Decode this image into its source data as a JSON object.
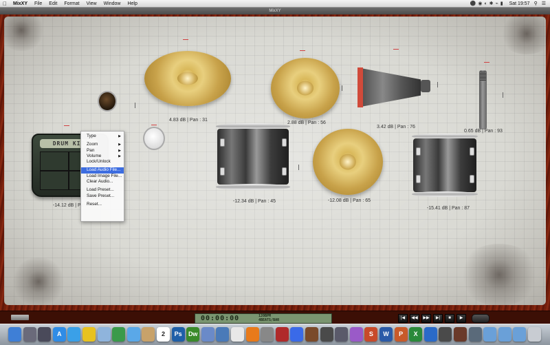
{
  "menubar": {
    "apple_icon": "apple-icon",
    "app_name": "MixXY",
    "items": [
      "File",
      "Edit",
      "Format",
      "View",
      "Window",
      "Help"
    ],
    "clock": "Sat 19:57"
  },
  "window": {
    "title": "MixXY"
  },
  "drum_kit": {
    "title": "DRUM KIT",
    "label": "-14.12 dB | Pan : 25"
  },
  "instruments": [
    {
      "name": "crash-cymbal",
      "label": "4.83 dB | Pan : 31"
    },
    {
      "name": "ride-cymbal",
      "label": "2.88 dB | Pan : 56"
    },
    {
      "name": "cowbell",
      "label": "3.42 dB | Pan : 76"
    },
    {
      "name": "microphone",
      "label": "0.65 dB | Pan : 93"
    },
    {
      "name": "tom-left",
      "label": "-12.34 dB | Pan : 45"
    },
    {
      "name": "china-cymbal",
      "label": "-12.08 dB | Pan : 65"
    },
    {
      "name": "tom-right",
      "label": "-15.41 dB | Pan : 87"
    }
  ],
  "context_menu": {
    "items": [
      {
        "label": "Type",
        "submenu": true
      },
      {
        "label": "Zoom",
        "submenu": true
      },
      {
        "label": "Pan",
        "submenu": true
      },
      {
        "label": "Volume",
        "submenu": true
      },
      {
        "label": "Lock/Unlock",
        "submenu": false
      },
      {
        "label": "Load Audio File...",
        "submenu": false,
        "highlighted": true
      },
      {
        "label": "Load Image File...",
        "submenu": false
      },
      {
        "label": "Clear Audio...",
        "submenu": false
      },
      {
        "label": "Load Preset...",
        "submenu": false
      },
      {
        "label": "Save Preset...",
        "submenu": false
      },
      {
        "label": "Reset...",
        "submenu": false
      }
    ]
  },
  "transport": {
    "time": "00:00:00",
    "bpm": "120BPM",
    "beats": "4BEATS/BAR",
    "buttons": [
      {
        "name": "go-to-start-button",
        "glyph": "|◀"
      },
      {
        "name": "rewind-button",
        "glyph": "◀◀"
      },
      {
        "name": "forward-button",
        "glyph": "▶▶"
      },
      {
        "name": "go-to-end-button",
        "glyph": "▶|"
      },
      {
        "name": "stop-button",
        "glyph": "■"
      },
      {
        "name": "play-button",
        "glyph": "▶"
      }
    ]
  },
  "dock": {
    "icons": [
      {
        "name": "finder-icon",
        "color": "#3f7fd6",
        "glyph": ""
      },
      {
        "name": "launchpad-icon",
        "color": "#6a6a7a",
        "glyph": ""
      },
      {
        "name": "mission-control-icon",
        "color": "#4a4a5a",
        "glyph": ""
      },
      {
        "name": "app-store-icon",
        "color": "#2f8ce6",
        "glyph": "A"
      },
      {
        "name": "safari-icon",
        "color": "#3aa0e8",
        "glyph": ""
      },
      {
        "name": "chrome-icon",
        "color": "#e8c21f",
        "glyph": ""
      },
      {
        "name": "mail-icon",
        "color": "#8fb4dc",
        "glyph": ""
      },
      {
        "name": "facetime-icon",
        "color": "#3a9a4a",
        "glyph": ""
      },
      {
        "name": "messages-icon",
        "color": "#5aa8e8",
        "glyph": ""
      },
      {
        "name": "contacts-icon",
        "color": "#c8a26a",
        "glyph": ""
      },
      {
        "name": "calendar-icon",
        "color": "#ffffff",
        "glyph": "2"
      },
      {
        "name": "photoshop-icon",
        "color": "#1f5fa8",
        "glyph": "Ps"
      },
      {
        "name": "dreamweaver-icon",
        "color": "#3a8a2a",
        "glyph": "Dw"
      },
      {
        "name": "preview-icon",
        "color": "#6a8ac8",
        "glyph": ""
      },
      {
        "name": "xcode-icon",
        "color": "#4a7ab8",
        "glyph": ""
      },
      {
        "name": "textedit-icon",
        "color": "#e8e8e8",
        "glyph": ""
      },
      {
        "name": "vlc-icon",
        "color": "#e87a1a",
        "glyph": ""
      },
      {
        "name": "system-preferences-icon",
        "color": "#888888",
        "glyph": ""
      },
      {
        "name": "book-icon",
        "color": "#b02a2a",
        "glyph": ""
      },
      {
        "name": "itunes-icon",
        "color": "#3a6ae8",
        "glyph": ""
      },
      {
        "name": "guitar-icon",
        "color": "#7a4a2a",
        "glyph": ""
      },
      {
        "name": "utility-icon",
        "color": "#4a4a4a",
        "glyph": ""
      },
      {
        "name": "dvd-player-icon",
        "color": "#5a5a6a",
        "glyph": ""
      },
      {
        "name": "game-center-icon",
        "color": "#9a5ac8",
        "glyph": ""
      },
      {
        "name": "sketch-icon",
        "color": "#c84a2a",
        "glyph": "S"
      },
      {
        "name": "word-icon",
        "color": "#2a5aa8",
        "glyph": "W"
      },
      {
        "name": "powerpoint-icon",
        "color": "#c85a2a",
        "glyph": "P"
      },
      {
        "name": "excel-icon",
        "color": "#2a8a3a",
        "glyph": "X"
      },
      {
        "name": "outlook-icon",
        "color": "#2a6ac8",
        "glyph": ""
      },
      {
        "name": "final-cut-icon",
        "color": "#4a4a4a",
        "glyph": ""
      },
      {
        "name": "mixxy-icon",
        "color": "#6a3a2a",
        "glyph": ""
      },
      {
        "name": "trash-folder-icon",
        "color": "#5a6a7a",
        "glyph": ""
      },
      {
        "name": "applications-folder-icon",
        "color": "#6aa0d8",
        "glyph": ""
      },
      {
        "name": "documents-folder-icon",
        "color": "#6aa0d8",
        "glyph": ""
      },
      {
        "name": "downloads-folder-icon",
        "color": "#6aa0d8",
        "glyph": ""
      },
      {
        "name": "trash-icon",
        "color": "#c8ccd2",
        "glyph": ""
      }
    ]
  }
}
